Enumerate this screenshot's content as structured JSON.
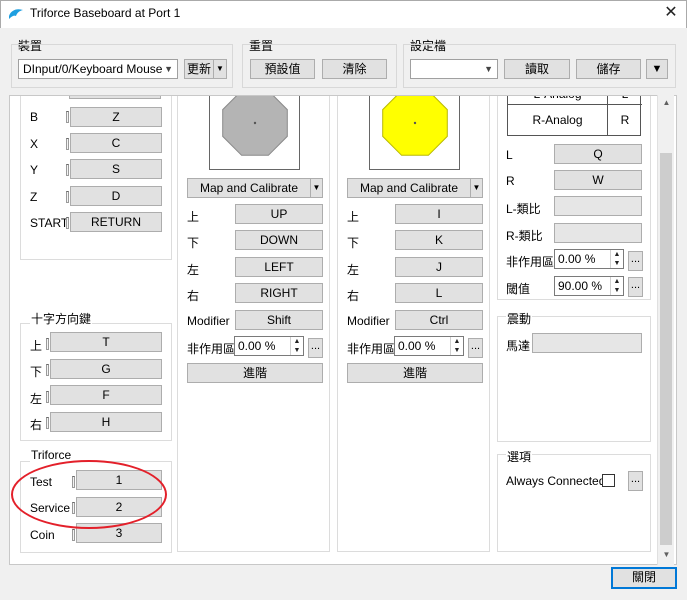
{
  "window": {
    "title": "Triforce Baseboard at Port 1",
    "close_glyph": "✕",
    "icon": "dolphin-icon"
  },
  "toolbar": {
    "device": {
      "label": "裝置",
      "value": "DInput/0/Keyboard Mouse",
      "refresh": "更新"
    },
    "reset": {
      "label": "重置",
      "default": "預設值",
      "clear": "清除"
    },
    "profile": {
      "label": "設定檔",
      "value": "",
      "load": "讀取",
      "save": "儲存"
    }
  },
  "col1": {
    "buttons": [
      {
        "label": "B",
        "value": "Z"
      },
      {
        "label": "X",
        "value": "C"
      },
      {
        "label": "Y",
        "value": "S"
      },
      {
        "label": "Z",
        "value": "D"
      },
      {
        "label": "START",
        "value": "RETURN"
      }
    ],
    "dpad": {
      "title": "十字方向鍵",
      "items": [
        {
          "label": "上",
          "value": "T"
        },
        {
          "label": "下",
          "value": "G"
        },
        {
          "label": "左",
          "value": "F"
        },
        {
          "label": "右",
          "value": "H"
        }
      ]
    },
    "triforce": {
      "title": "Triforce",
      "items": [
        {
          "label": "Test",
          "value": "1"
        },
        {
          "label": "Service",
          "value": "2"
        },
        {
          "label": "Coin",
          "value": "3"
        }
      ]
    }
  },
  "main_stick": {
    "color": "#b4b4b4",
    "map_button": "Map and Calibrate",
    "items": [
      {
        "label": "上",
        "value": "UP"
      },
      {
        "label": "下",
        "value": "DOWN"
      },
      {
        "label": "左",
        "value": "LEFT"
      },
      {
        "label": "右",
        "value": "RIGHT"
      },
      {
        "label": "Modifier",
        "value": "Shift"
      }
    ],
    "deadzone_label": "非作用區",
    "deadzone_value": "0.00 %",
    "advanced": "進階"
  },
  "c_stick": {
    "color": "#ffff00",
    "map_button": "Map and Calibrate",
    "items": [
      {
        "label": "上",
        "value": "I"
      },
      {
        "label": "下",
        "value": "K"
      },
      {
        "label": "左",
        "value": "J"
      },
      {
        "label": "右",
        "value": "L"
      },
      {
        "label": "Modifier",
        "value": "Ctrl"
      }
    ],
    "deadzone_label": "非作用區",
    "deadzone_value": "0.00 %",
    "advanced": "進階"
  },
  "triggers": {
    "table": [
      {
        "name": "L-Analog",
        "key": "L"
      },
      {
        "name": "R-Analog",
        "key": "R"
      }
    ],
    "items": [
      {
        "label": "L",
        "value": "Q"
      },
      {
        "label": "R",
        "value": "W"
      },
      {
        "label": "L-類比",
        "value": ""
      },
      {
        "label": "R-類比",
        "value": ""
      }
    ],
    "deadzone_label": "非作用區",
    "deadzone_value": "0.00 %",
    "threshold_label": "閾值",
    "threshold_value": "90.00 %"
  },
  "rumble": {
    "title": "震動",
    "motor_label": "馬達",
    "motor_value": ""
  },
  "options": {
    "title": "選項",
    "always_connected": "Always Connected",
    "checked": false
  },
  "footer": {
    "close": "關閉"
  },
  "annotation": {
    "color": "#e3202a"
  },
  "spin_glyphs": {
    "up": "▲",
    "down": "▼"
  },
  "ellipsis": "..."
}
